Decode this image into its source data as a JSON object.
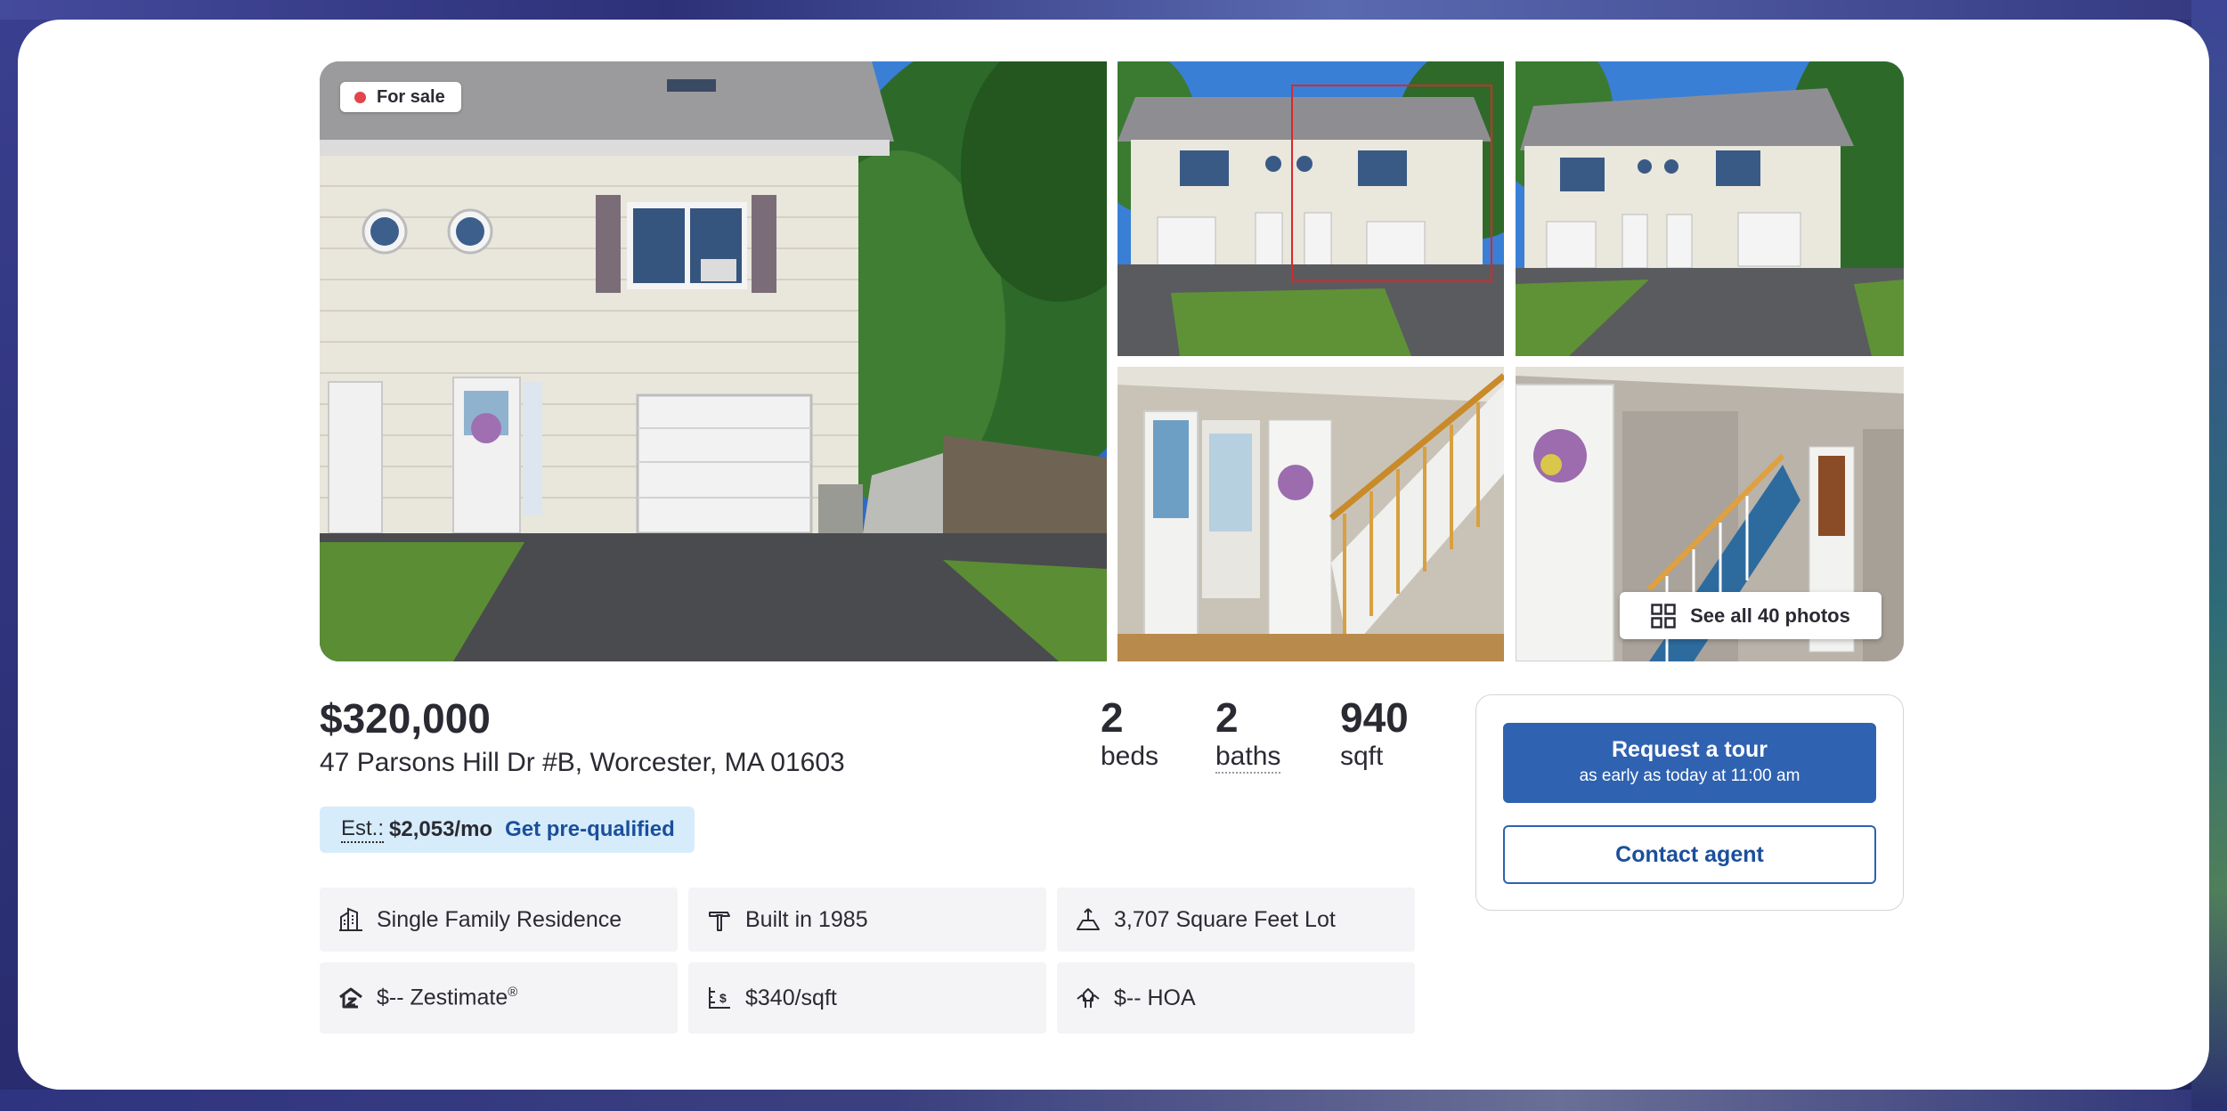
{
  "badge": {
    "label": "For sale",
    "color": "#e2454c"
  },
  "gallery": {
    "see_all": "See all 40 photos"
  },
  "listing": {
    "price": "$320,000",
    "address": "47 Parsons Hill Dr #B, Worcester, MA 01603"
  },
  "stats": {
    "beds": {
      "value": "2",
      "label": "beds"
    },
    "baths": {
      "value": "2",
      "label": "baths"
    },
    "sqft": {
      "value": "940",
      "label": "sqft"
    }
  },
  "estimate": {
    "label": "Est.:",
    "value": "$2,053/mo",
    "link": "Get pre-qualified"
  },
  "facts": {
    "type": "Single Family Residence",
    "built": "Built in 1985",
    "lot": "3,707 Square Feet Lot",
    "zestimate": "$-- Zestimate",
    "zestimate_mark": "®",
    "price_per_sqft": "$340/sqft",
    "hoa": "$-- HOA"
  },
  "actions": {
    "tour_title": "Request a tour",
    "tour_subtitle": "as early as today at 11:00 am",
    "contact": "Contact agent"
  },
  "colors": {
    "primary": "#2f62b0",
    "link": "#1b4f9c",
    "estimate_bg": "#d6ecfb",
    "fact_bg": "#f4f4f6"
  }
}
